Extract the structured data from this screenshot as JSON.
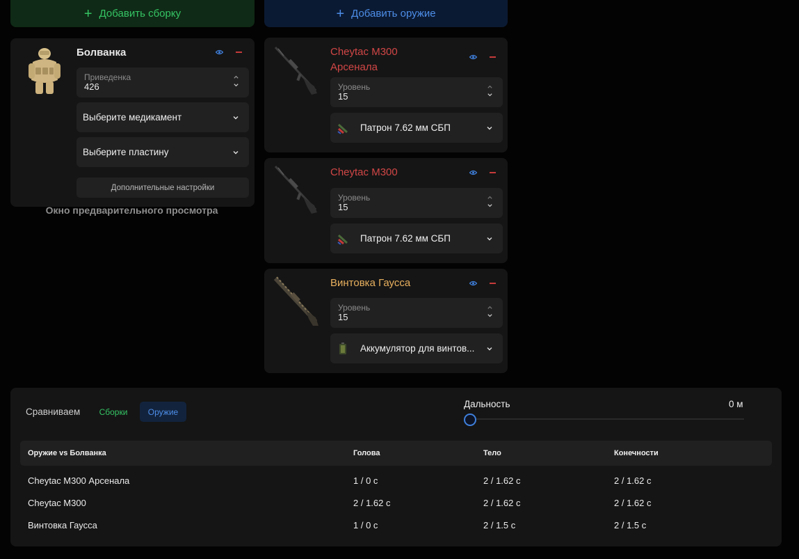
{
  "buttons": {
    "add_build": "Добавить сборку",
    "add_weapon": "Добавить оружие",
    "plus": "+"
  },
  "dummy": {
    "name": "Болванка",
    "field_label": "Приведенка",
    "field_value": "426",
    "medicine_placeholder": "Выберите медикамент",
    "plate_placeholder": "Выберите пластину",
    "advanced_settings": "Дополнительные настройки"
  },
  "weapons": [
    {
      "name": "Cheytac M300 Арсенала",
      "color": "#d24646",
      "level_label": "Уровень",
      "level": "15",
      "ammo": "Патрон 7.62 мм СБП"
    },
    {
      "name": "Cheytac M300",
      "color": "#d24646",
      "level_label": "Уровень",
      "level": "15",
      "ammo": "Патрон 7.62 мм СБП"
    },
    {
      "name": "Винтовка Гаусса",
      "color": "#e8b05e",
      "level_label": "Уровень",
      "level": "15",
      "ammo": "Аккумулятор для винтов..."
    }
  ],
  "preview": {
    "text": "Окно предварительного просмотра",
    "icon": "eye-icon"
  },
  "compare": {
    "label": "Сравниваем",
    "tab_builds": "Сборки",
    "tab_weapons": "Оружие",
    "active_tab": "Оружие",
    "range_label": "Дальность",
    "range_value": "0 м",
    "range_fraction": 0
  },
  "table": {
    "headers": [
      "Оружие vs Болванка",
      "Голова",
      "Тело",
      "Конечности"
    ],
    "rows": [
      [
        "Cheytac M300 Арсенала",
        "1 / 0 с",
        "2 / 1.62 с",
        "2 / 1.62 с"
      ],
      [
        "Cheytac M300",
        "2 / 1.62 с",
        "2 / 1.62 с",
        "2 / 1.62 с"
      ],
      [
        "Винтовка Гаусса",
        "1 / 0 с",
        "2 / 1.5 с",
        "2 / 1.5 с"
      ]
    ]
  },
  "colors": {
    "green": "#35c464",
    "blue": "#4d8ee8",
    "red": "#d24646",
    "legendary": "#e8b05e",
    "card_bg": "#151515",
    "field_bg": "#212121"
  }
}
